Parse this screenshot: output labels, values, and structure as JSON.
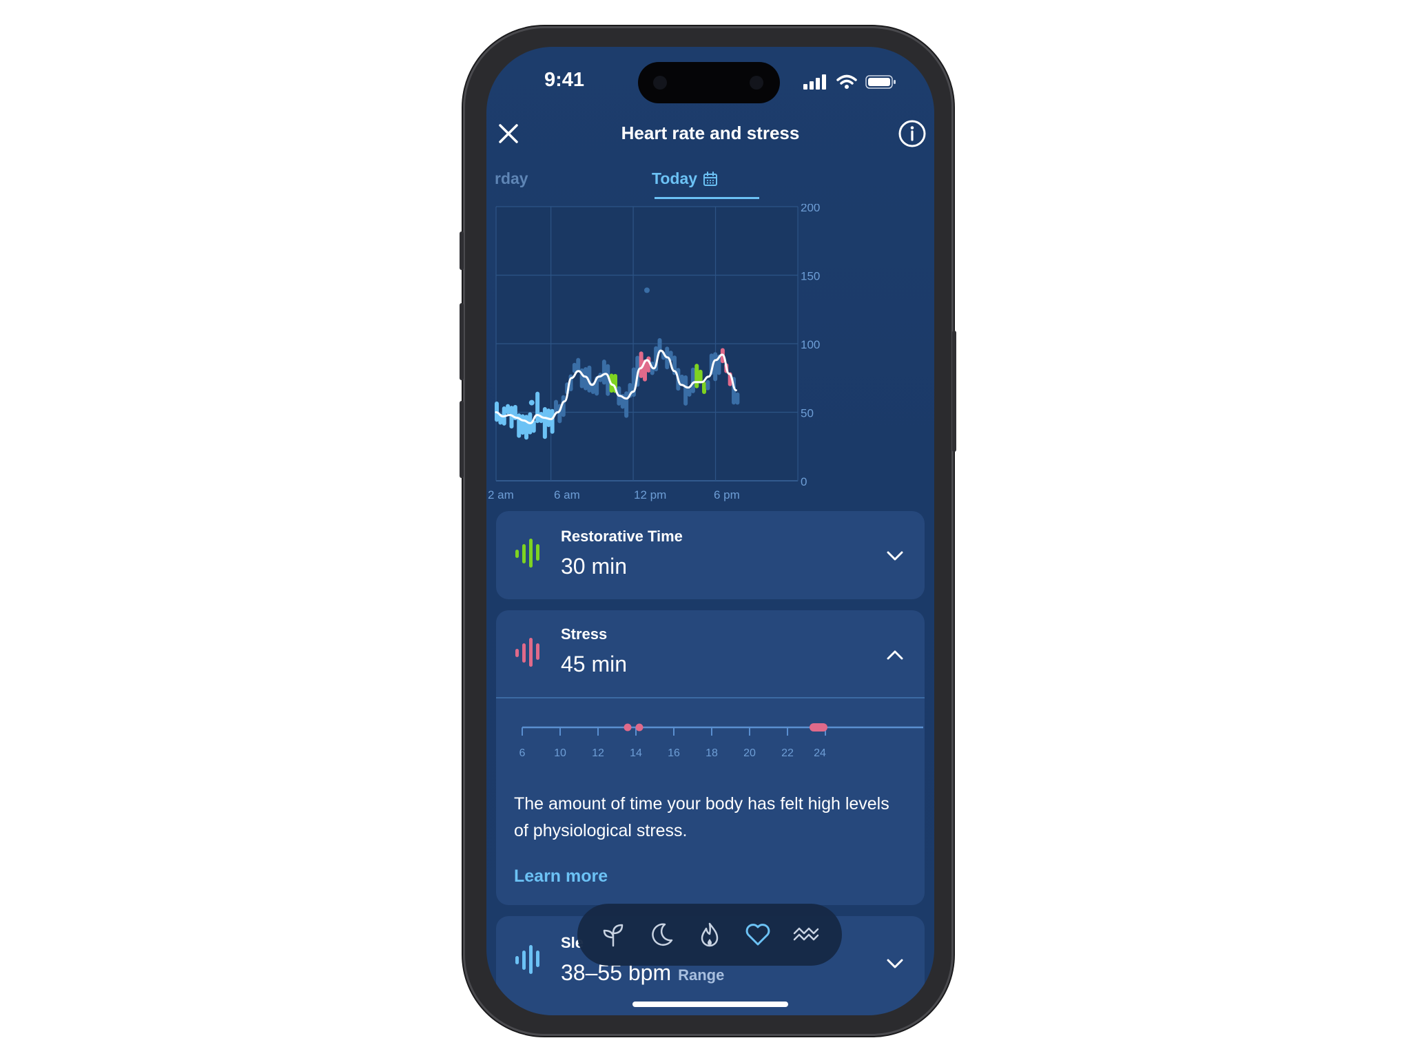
{
  "status_bar": {
    "time": "9:41"
  },
  "header": {
    "title": "Heart rate and stress"
  },
  "tabs": {
    "previous": "rday",
    "current": "Today"
  },
  "chart_data": {
    "type": "line",
    "y_ticks": [
      "200",
      "150",
      "100",
      "50",
      "0"
    ],
    "x_ticks": [
      "2 am",
      "6 am",
      "12 pm",
      "6 pm"
    ],
    "ylim": [
      0,
      200
    ],
    "grid": true,
    "colors": {
      "line": "#ffffff",
      "range": "#3a6ea6",
      "low": "#6cc2f5",
      "restorative": "#7ed321",
      "stress": "#e06a8a"
    },
    "series": [
      {
        "x": [
          2,
          2.5,
          3,
          3.5,
          4,
          4.5,
          5,
          5.5,
          6,
          6.5,
          7,
          7.5,
          8,
          8.5,
          9,
          9.5,
          10,
          10.5,
          11,
          11.5,
          12,
          12.5,
          13,
          13.5,
          14,
          14.5,
          15,
          15.5,
          16,
          16.5,
          17,
          17.5,
          18,
          18.5,
          19,
          19.5
        ],
        "y": [
          50,
          47,
          48,
          46,
          44,
          42,
          48,
          46,
          45,
          50,
          58,
          75,
          80,
          76,
          70,
          76,
          78,
          70,
          62,
          60,
          65,
          82,
          88,
          82,
          95,
          90,
          80,
          70,
          68,
          72,
          72,
          76,
          88,
          92,
          78,
          66
        ]
      }
    ]
  },
  "cards": {
    "restorative": {
      "label": "Restorative Time",
      "value": "30 min"
    },
    "stress": {
      "label": "Stress",
      "value": "45 min",
      "timeline_ticks": [
        "6",
        "10",
        "12",
        "14",
        "16",
        "18",
        "20",
        "22",
        "24"
      ],
      "description": "The amount of time your body has felt high levels of physiological stress.",
      "link": "Learn more"
    },
    "sleeping_hr": {
      "label": "Sle",
      "value": "38–55 bpm",
      "sub": "Range"
    }
  },
  "bottom_nav": {
    "icons": [
      "sprout-icon",
      "moon-icon",
      "flame-icon",
      "heart-icon",
      "waves-icon"
    ]
  }
}
